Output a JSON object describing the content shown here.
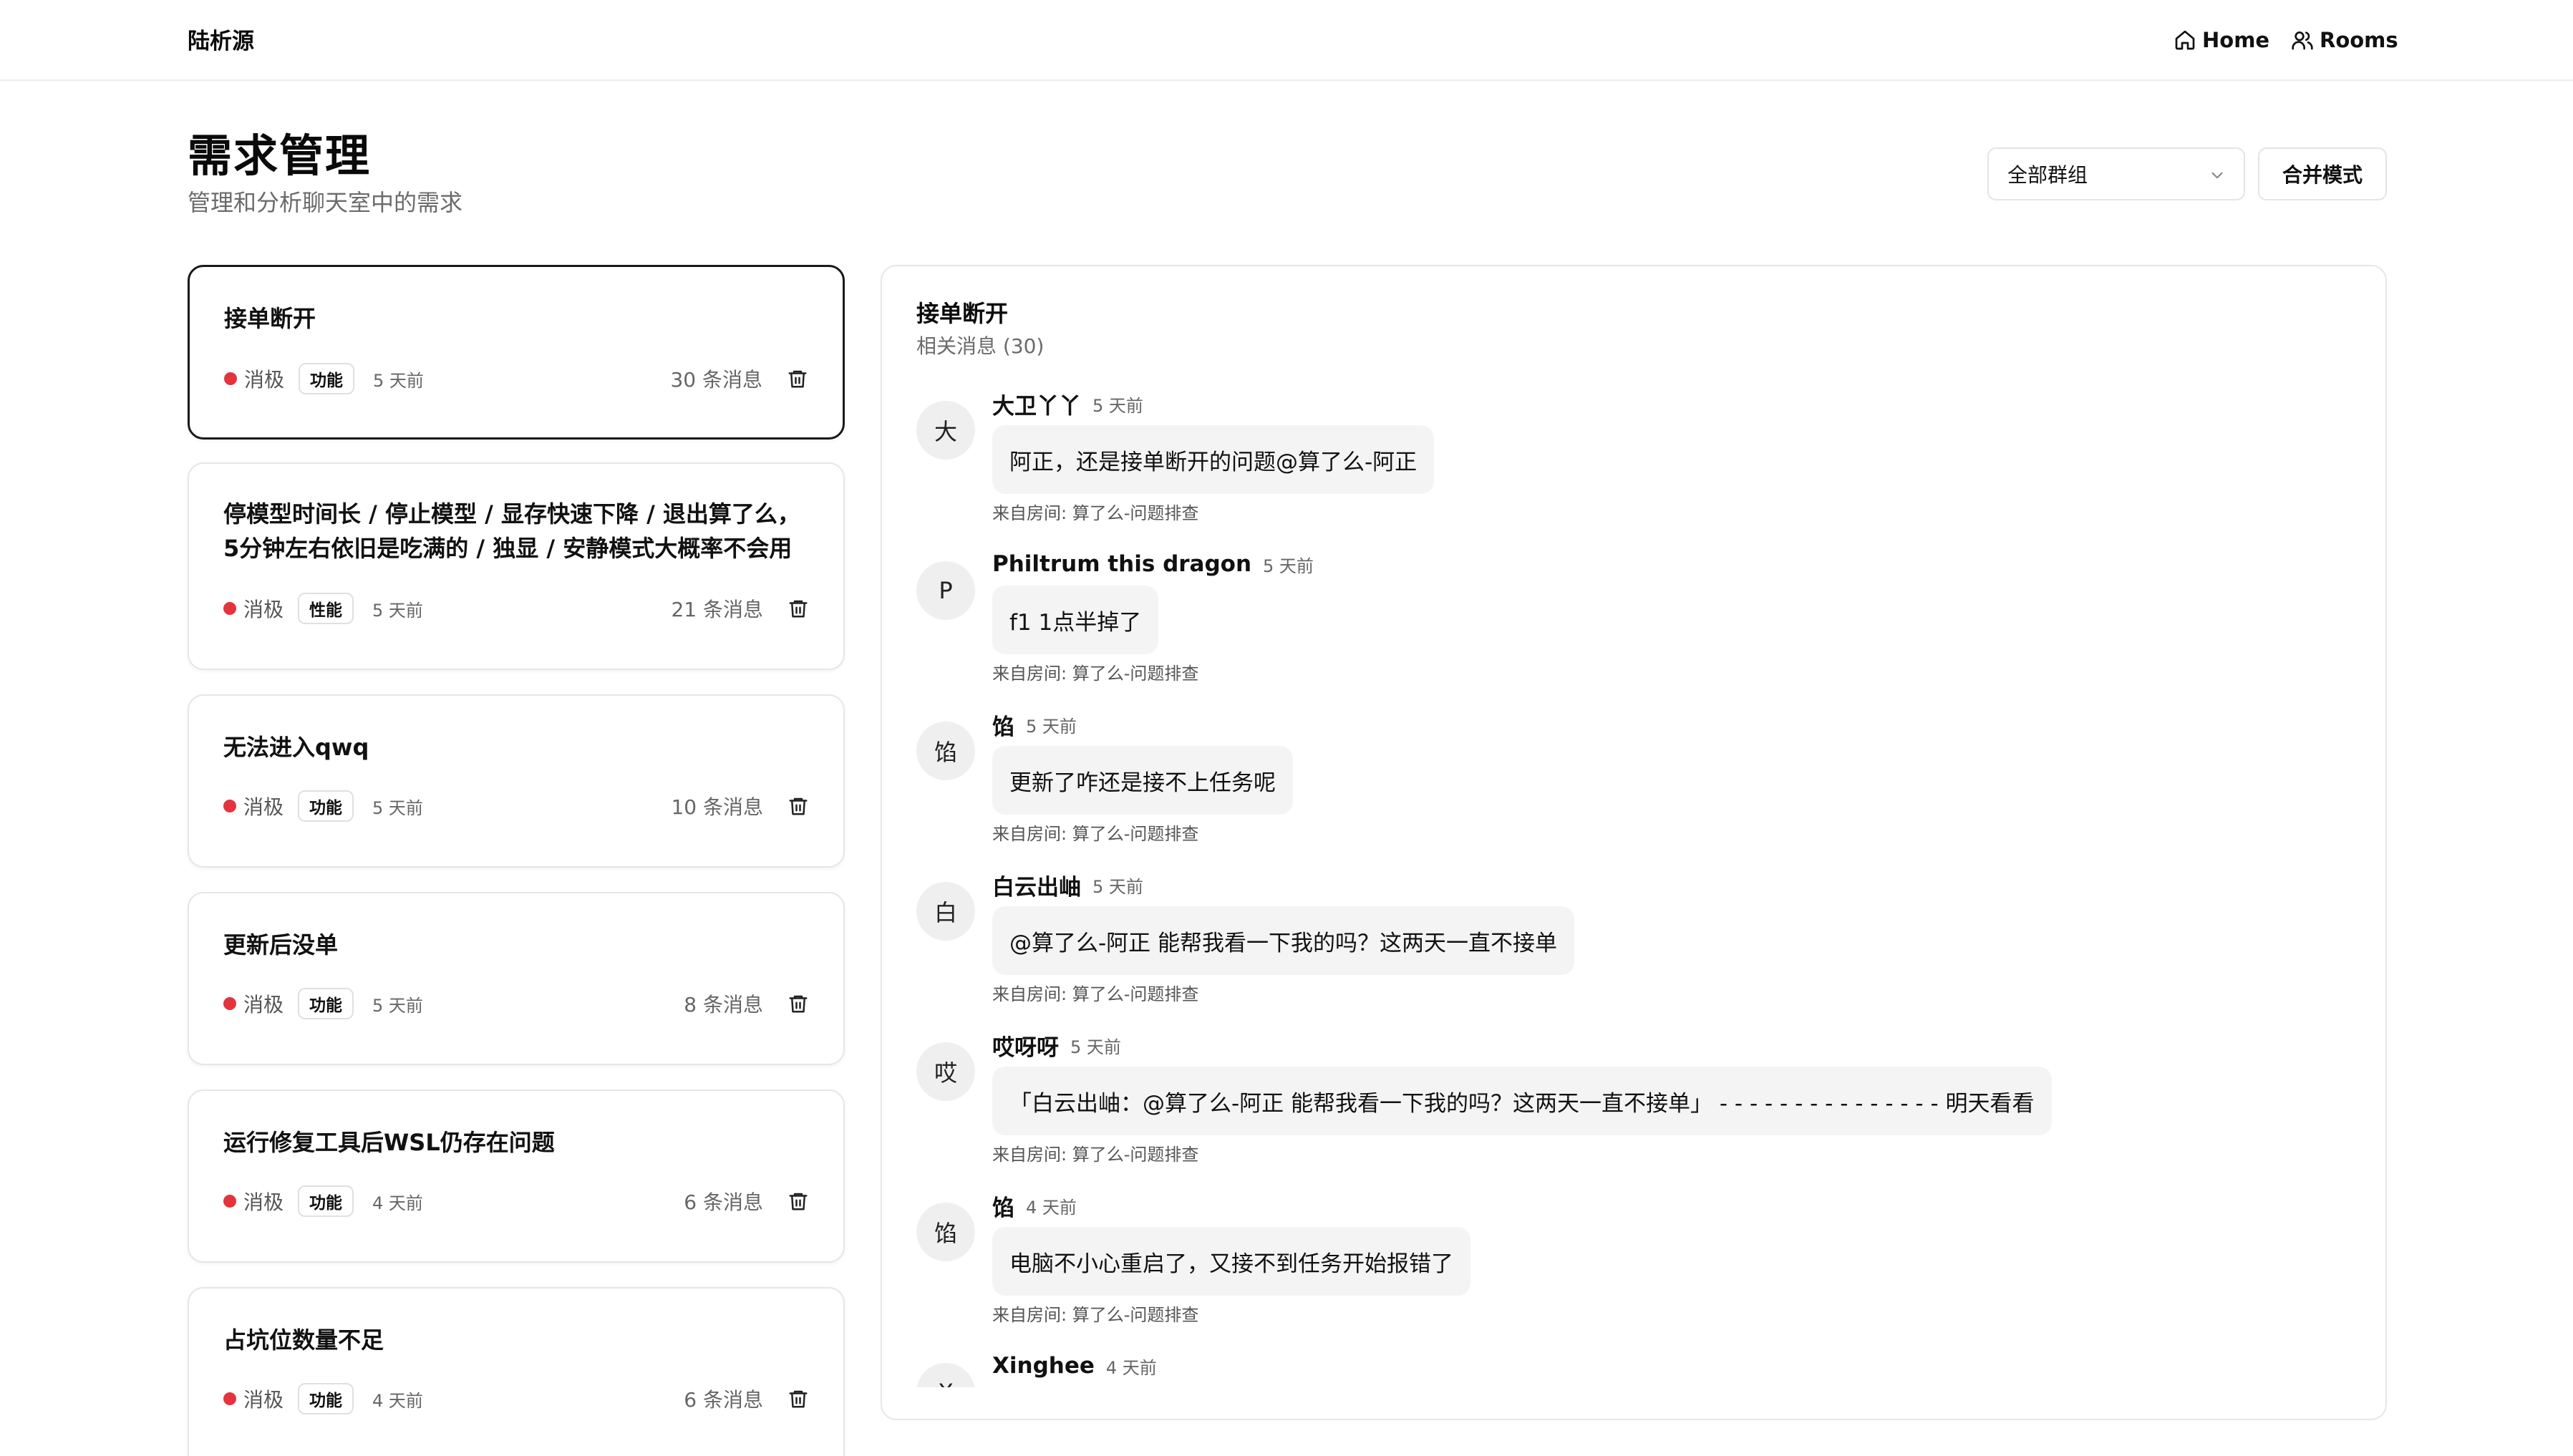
{
  "nav": {
    "brand": "陆析源",
    "home": "Home",
    "rooms": "Rooms"
  },
  "header": {
    "title": "需求管理",
    "subtitle": "管理和分析聊天室中的需求",
    "group_select": "全部群组",
    "merge_button": "合并模式"
  },
  "requirements": [
    {
      "title": "接单断开",
      "sentiment": "消极",
      "tag": "功能",
      "time": "5 天前",
      "count": "30 条消息"
    },
    {
      "title": "停模型时间长 / 停止模型 / 显存快速下降 / 退出算了么，5分钟左右依旧是吃满的 / 独显 / 安静模式大概率不会用独...",
      "sentiment": "消极",
      "tag": "性能",
      "time": "5 天前",
      "count": "21 条消息"
    },
    {
      "title": "无法进入qwq",
      "sentiment": "消极",
      "tag": "功能",
      "time": "5 天前",
      "count": "10 条消息"
    },
    {
      "title": "更新后没单",
      "sentiment": "消极",
      "tag": "功能",
      "time": "5 天前",
      "count": "8 条消息"
    },
    {
      "title": "运行修复工具后WSL仍存在问题",
      "sentiment": "消极",
      "tag": "功能",
      "time": "4 天前",
      "count": "6 条消息"
    },
    {
      "title": "占坑位数量不足",
      "sentiment": "消极",
      "tag": "功能",
      "time": "4 天前",
      "count": "6 条消息"
    }
  ],
  "detail": {
    "title": "接单断开",
    "subtitle": "相关消息 (30)",
    "messages": [
      {
        "avatar": "大",
        "sender": "大卫丫丫",
        "time": "5 天前",
        "text": "阿正，还是接单断开的问题@算了么-阿正",
        "source": "来自房间: 算了么-问题排查"
      },
      {
        "avatar": "P",
        "sender": "Philtrum this dragon",
        "time": "5 天前",
        "text": "f1 1点半掉了",
        "source": "来自房间: 算了么-问题排查"
      },
      {
        "avatar": "馅",
        "sender": "馅",
        "time": "5 天前",
        "text": "更新了咋还是接不上任务呢",
        "source": "来自房间: 算了么-问题排查"
      },
      {
        "avatar": "白",
        "sender": "白云出岫",
        "time": "5 天前",
        "text": "@算了么-阿正 能帮我看一下我的吗？这两天一直不接单",
        "source": "来自房间: 算了么-问题排查"
      },
      {
        "avatar": "哎",
        "sender": "哎呀呀",
        "time": "5 天前",
        "text": "「白云出岫：@算了么-阿正 能帮我看一下我的吗？这两天一直不接单」 - - - - - - - - - - - - - - - 明天看看",
        "source": "来自房间: 算了么-问题排查"
      },
      {
        "avatar": "馅",
        "sender": "馅",
        "time": "4 天前",
        "text": "电脑不小心重启了，又接不到任务开始报错了",
        "source": "来自房间: 算了么-问题排查"
      },
      {
        "avatar": "X",
        "sender": "Xinghee",
        "time": "4 天前",
        "text": "",
        "source": ""
      }
    ]
  }
}
